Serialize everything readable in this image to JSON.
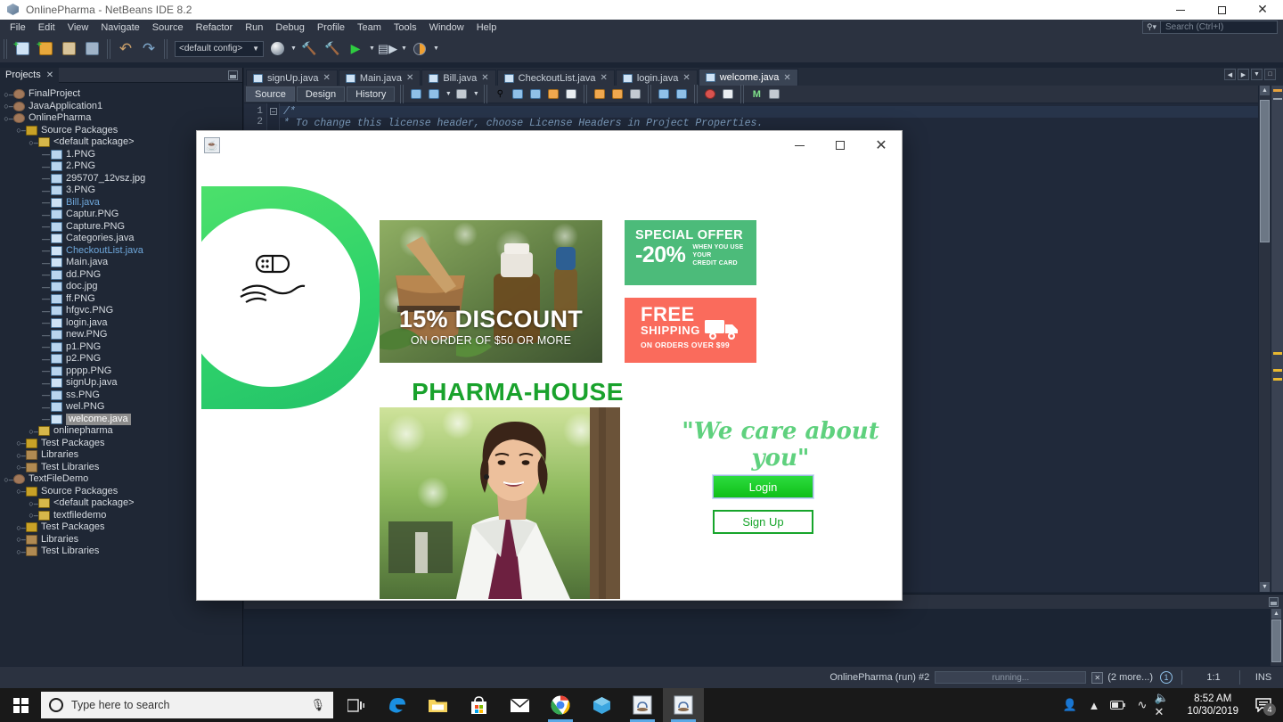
{
  "window": {
    "title": "OnlinePharma - NetBeans IDE 8.2",
    "icon": "netbeans-cube-icon",
    "minimize": "minimize",
    "maximize": "maximize",
    "close": "close"
  },
  "menubar": {
    "items": [
      "File",
      "Edit",
      "View",
      "Navigate",
      "Source",
      "Refactor",
      "Run",
      "Debug",
      "Profile",
      "Team",
      "Tools",
      "Window",
      "Help"
    ],
    "search_placeholder": "Search (Ctrl+I)"
  },
  "toolbar": {
    "config_value": "<default config>",
    "buttons": [
      "new-file",
      "new-project",
      "open-project",
      "save-all",
      "undo",
      "redo",
      "config-select",
      "build-project",
      "clean-build",
      "run-project",
      "debug-project",
      "profile-project"
    ]
  },
  "projects_panel": {
    "tab_label": "Projects",
    "tree": [
      {
        "label": "FinalProject",
        "depth": 0,
        "icon": "project-icon",
        "handle": "collapsed"
      },
      {
        "label": "JavaApplication1",
        "depth": 0,
        "icon": "project-icon",
        "handle": "collapsed"
      },
      {
        "label": "OnlinePharma",
        "depth": 0,
        "icon": "project-icon-main",
        "handle": "expanded"
      },
      {
        "label": "Source Packages",
        "depth": 1,
        "icon": "packages-icon",
        "handle": "expanded"
      },
      {
        "label": "<default package>",
        "depth": 2,
        "icon": "package-icon",
        "handle": "expanded"
      },
      {
        "label": "1.PNG",
        "depth": 3,
        "icon": "image-icon",
        "handle": "leaf"
      },
      {
        "label": "2.PNG",
        "depth": 3,
        "icon": "image-icon",
        "handle": "leaf"
      },
      {
        "label": "295707_12vsz.jpg",
        "depth": 3,
        "icon": "image-icon",
        "handle": "leaf"
      },
      {
        "label": "3.PNG",
        "depth": 3,
        "icon": "image-icon",
        "handle": "leaf"
      },
      {
        "label": "Bill.java",
        "depth": 3,
        "icon": "java-icon",
        "handle": "leaf",
        "style": "java"
      },
      {
        "label": "Captur.PNG",
        "depth": 3,
        "icon": "image-icon",
        "handle": "leaf"
      },
      {
        "label": "Capture.PNG",
        "depth": 3,
        "icon": "image-icon",
        "handle": "leaf"
      },
      {
        "label": "Categories.java",
        "depth": 3,
        "icon": "java-icon",
        "handle": "leaf"
      },
      {
        "label": "CheckoutList.java",
        "depth": 3,
        "icon": "java-icon",
        "handle": "leaf",
        "style": "java"
      },
      {
        "label": "Main.java",
        "depth": 3,
        "icon": "java-icon",
        "handle": "leaf"
      },
      {
        "label": "dd.PNG",
        "depth": 3,
        "icon": "image-icon",
        "handle": "leaf"
      },
      {
        "label": "doc.jpg",
        "depth": 3,
        "icon": "image-icon",
        "handle": "leaf"
      },
      {
        "label": "ff.PNG",
        "depth": 3,
        "icon": "image-icon",
        "handle": "leaf"
      },
      {
        "label": "hfgvc.PNG",
        "depth": 3,
        "icon": "image-icon",
        "handle": "leaf"
      },
      {
        "label": "login.java",
        "depth": 3,
        "icon": "java-icon",
        "handle": "leaf"
      },
      {
        "label": "new.PNG",
        "depth": 3,
        "icon": "image-icon",
        "handle": "leaf"
      },
      {
        "label": "p1.PNG",
        "depth": 3,
        "icon": "image-icon",
        "handle": "leaf"
      },
      {
        "label": "p2.PNG",
        "depth": 3,
        "icon": "image-icon",
        "handle": "leaf"
      },
      {
        "label": "pppp.PNG",
        "depth": 3,
        "icon": "image-icon",
        "handle": "leaf"
      },
      {
        "label": "signUp.java",
        "depth": 3,
        "icon": "java-icon",
        "handle": "leaf"
      },
      {
        "label": "ss.PNG",
        "depth": 3,
        "icon": "image-icon",
        "handle": "leaf"
      },
      {
        "label": "wel.PNG",
        "depth": 3,
        "icon": "image-icon",
        "handle": "leaf"
      },
      {
        "label": "welcome.java",
        "depth": 3,
        "icon": "java-icon",
        "handle": "leaf",
        "style": "selected"
      },
      {
        "label": "onlinepharma",
        "depth": 2,
        "icon": "package-icon",
        "handle": "collapsed"
      },
      {
        "label": "Test Packages",
        "depth": 1,
        "icon": "packages-icon",
        "handle": "collapsed"
      },
      {
        "label": "Libraries",
        "depth": 1,
        "icon": "library-icon",
        "handle": "collapsed"
      },
      {
        "label": "Test Libraries",
        "depth": 1,
        "icon": "library-icon",
        "handle": "collapsed"
      },
      {
        "label": "TextFileDemo",
        "depth": 0,
        "icon": "project-icon",
        "handle": "expanded"
      },
      {
        "label": "Source Packages",
        "depth": 1,
        "icon": "packages-icon",
        "handle": "expanded"
      },
      {
        "label": "<default package>",
        "depth": 2,
        "icon": "package-icon",
        "handle": "collapsed"
      },
      {
        "label": "textfiledemo",
        "depth": 2,
        "icon": "package-icon",
        "handle": "collapsed"
      },
      {
        "label": "Test Packages",
        "depth": 1,
        "icon": "packages-icon",
        "handle": "collapsed"
      },
      {
        "label": "Libraries",
        "depth": 1,
        "icon": "library-icon",
        "handle": "collapsed"
      },
      {
        "label": "Test Libraries",
        "depth": 1,
        "icon": "library-icon",
        "handle": "collapsed"
      }
    ]
  },
  "editor": {
    "tabs": [
      {
        "label": "signUp.java",
        "active": false
      },
      {
        "label": "Main.java",
        "active": false
      },
      {
        "label": "Bill.java",
        "active": false
      },
      {
        "label": "CheckoutList.java",
        "active": false
      },
      {
        "label": "login.java",
        "active": false
      },
      {
        "label": "welcome.java",
        "active": true
      }
    ],
    "view_buttons": [
      "Source",
      "Design",
      "History"
    ],
    "active_view": "Source",
    "code_lines": [
      {
        "num": "1",
        "text": "/*"
      },
      {
        "num": "2",
        "text": " * To change this license header, choose License Headers in Project Properties."
      }
    ]
  },
  "statusbar": {
    "task": "OnlinePharma (run) #2",
    "progress_label": "running...",
    "more": "(2 more...)",
    "notifications": "1",
    "position": "1:1",
    "insert_mode": "INS"
  },
  "dialog": {
    "icon": "java-coffee-icon",
    "minimize": "minimize",
    "maximize": "maximize",
    "close": "close",
    "logo_glyph": "pill-in-hand-icon",
    "hero": {
      "headline": "15% DISCOUNT",
      "subline": "ON ORDER OF $50 OR MORE"
    },
    "offer_card": {
      "title": "SPECIAL OFFER",
      "percent": "-20%",
      "fine_line1": "WHEN YOU USE YOUR",
      "fine_line2": "CREDIT CARD",
      "color": "#4cbb7a"
    },
    "shipping_card": {
      "free": "FREE",
      "shipping": "SHIPPING",
      "orders": "ON ORDERS OVER $99",
      "icon": "delivery-truck-icon",
      "color": "#fa6b5c"
    },
    "brand": "PHARMA-HOUSE",
    "brand_color": "#19a22c",
    "doctor_photo": "pharmacist-photo",
    "tagline": "\"We care about you\"",
    "login_button": "Login",
    "signup_button": "Sign Up"
  },
  "taskbar": {
    "start": "start-button",
    "search_placeholder": "Type here to search",
    "mic": "microphone-icon",
    "apps": [
      "task-view-icon",
      "edge-icon",
      "file-explorer-icon",
      "microsoft-store-icon",
      "mail-icon",
      "chrome-icon",
      "virtualbox-icon",
      "netbeans-icon",
      "java-app-icon"
    ],
    "tray": [
      "people-icon",
      "show-hidden-icons-icon",
      "battery-icon",
      "wifi-icon",
      "volume-muted-icon"
    ],
    "time": "8:52 AM",
    "date": "10/30/2019",
    "notification_count": "4"
  }
}
